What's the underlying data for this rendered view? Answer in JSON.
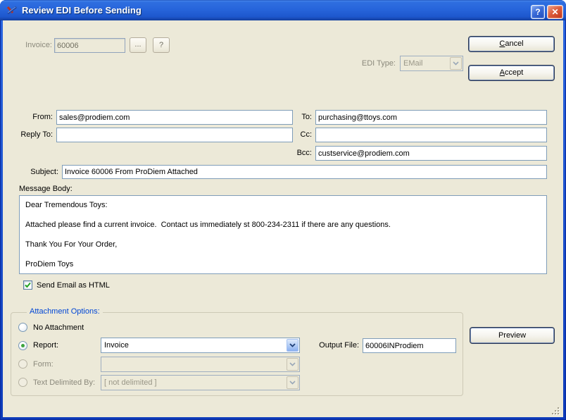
{
  "window": {
    "title": "Review EDI Before Sending",
    "help_glyph": "?",
    "close_glyph": "✕"
  },
  "header": {
    "invoice_label": "Invoice:",
    "invoice_value": "60006",
    "browse_label": "...",
    "question_label": "?",
    "edi_type_label": "EDI Type:",
    "edi_type_value": "EMail",
    "cancel_label": "Cancel",
    "accept_label": "Accept"
  },
  "email": {
    "from_label": "From:",
    "from_value": "sales@prodiem.com",
    "to_label": "To:",
    "to_value": "purchasing@ttoys.com",
    "reply_to_label": "Reply To:",
    "reply_to_value": "",
    "cc_label": "Cc:",
    "cc_value": "",
    "bcc_label": "Bcc:",
    "bcc_value": "custservice@prodiem.com",
    "subject_label": "Subject:",
    "subject_value": "Invoice 60006 From ProDiem Attached",
    "message_body_label": "Message Body:",
    "message_body": "Dear Tremendous Toys:\n\nAttached please find a current invoice.  Contact us immediately st 800-234-2311 if there are any questions.\n\nThank You For Your Order,\n\nProDiem Toys",
    "send_html_label": "Send Email as HTML",
    "send_html_checked": true
  },
  "attachment": {
    "group_label": "Attachment Options:",
    "no_attachment_label": "No Attachment",
    "report_label": "Report:",
    "report_value": "Invoice",
    "output_file_label": "Output File:",
    "output_file_value": "60006INProdiem",
    "form_label": "Form:",
    "form_value": "",
    "text_delimited_label": "Text Delimited By:",
    "text_delimited_value": "[ not delimited ]",
    "preview_label": "Preview"
  },
  "colors": {
    "dialog_bg": "#ECE9D8",
    "titlebar_blue": "#2765DB",
    "group_label_blue": "#0046D5",
    "check_green": "#21A121",
    "radio_green": "#3DA43D",
    "field_border": "#7F9DB9",
    "disabled_text": "#8B897C",
    "close_red": "#DD5E3D"
  }
}
